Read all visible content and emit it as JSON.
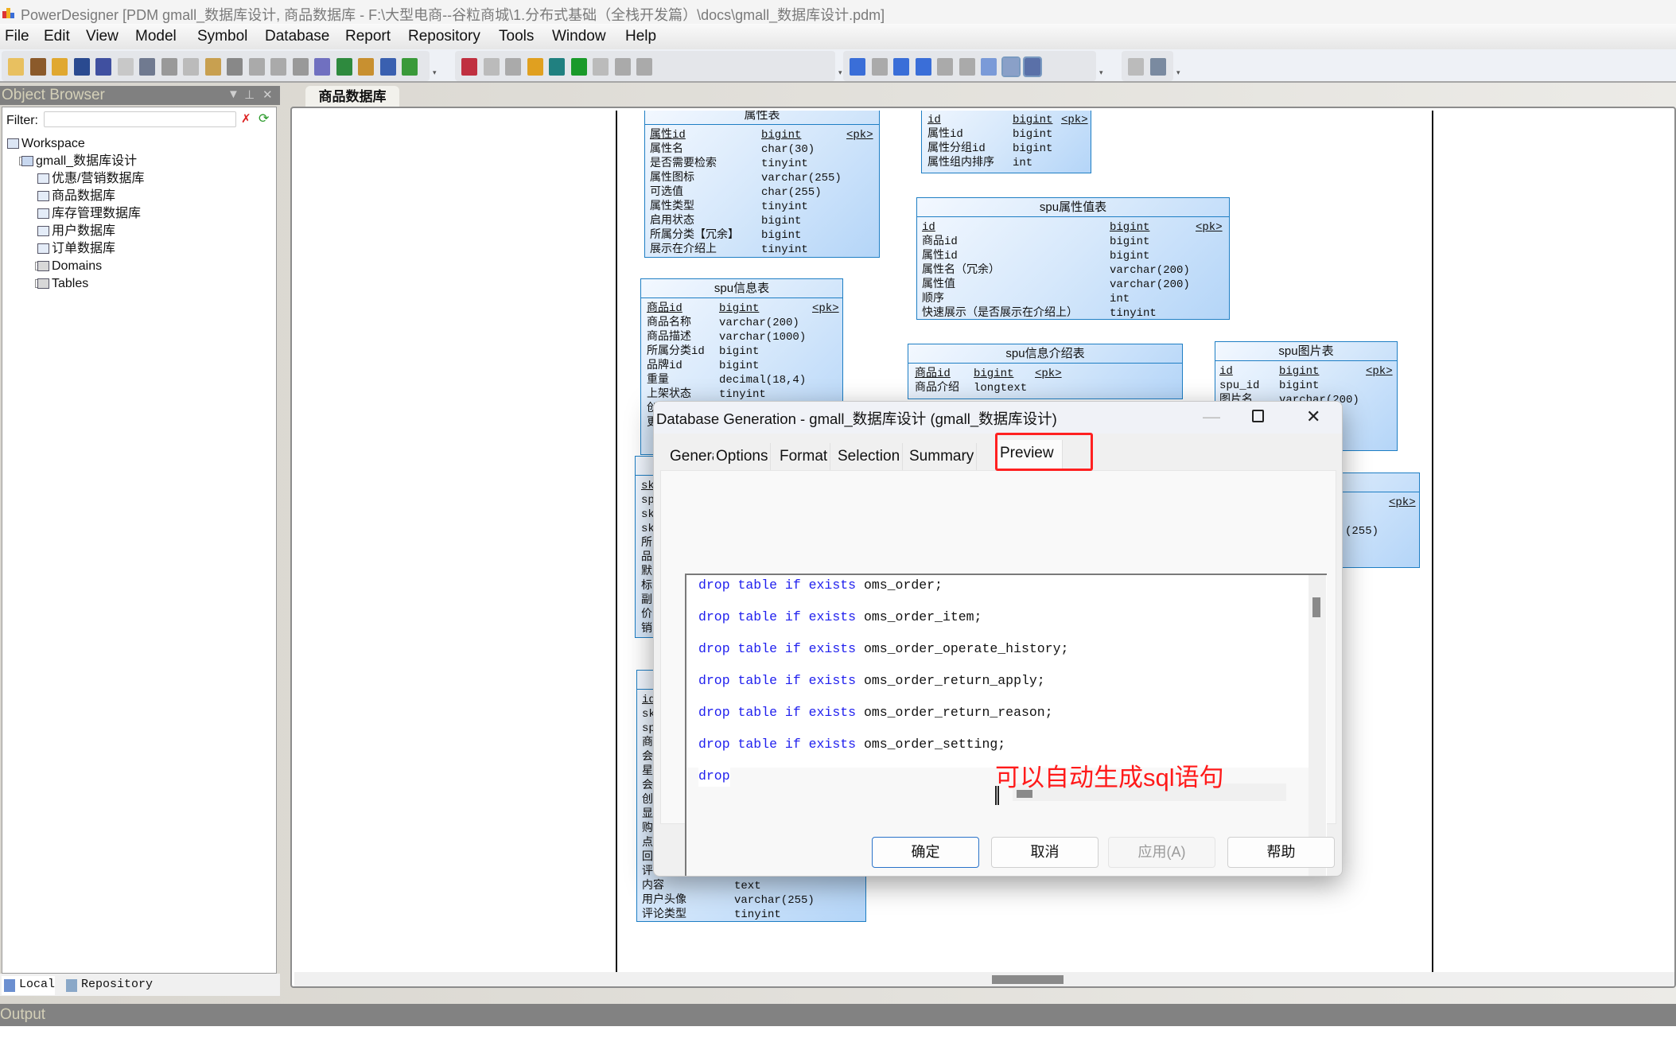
{
  "window": {
    "title": "PowerDesigner [PDM gmall_数据库设计, 商品数据库 - F:\\大型电商--谷粒商城\\1.分布式基础（全栈开发篇）\\docs\\gmall_数据库设计.pdm]"
  },
  "menu": [
    "File",
    "Edit",
    "View",
    "Model",
    "Symbol",
    "Database",
    "Report",
    "Repository",
    "Tools",
    "Window",
    "Help"
  ],
  "toolbar": {
    "icons": [
      "new-icon",
      "open-project-icon",
      "open-icon",
      "save-icon",
      "save-all-icon",
      "print-preview-icon",
      "print-icon",
      "cut-icon",
      "copy-icon",
      "paste-icon",
      "delete-icon",
      "undo-icon",
      "redo-icon",
      "properties-icon",
      "help-icon",
      "new-model-icon",
      "import-icon",
      "reverse-icon",
      "refresh-icon",
      "check-model-icon",
      "shadow-icon",
      "text-icon",
      "pen-icon",
      "fill-icon",
      "font-icon",
      "align-icon",
      "back-icon",
      "forward-icon",
      "diagram-icon",
      "object-icon",
      "package-icon",
      "list-icon",
      "link-icon",
      "entity-icon",
      "find-icon",
      "output-icon",
      "grid-icon",
      "zoom-icon",
      "printer-icon"
    ]
  },
  "object_browser": {
    "title": "Object Browser",
    "filter_label": "Filter:",
    "filter_value": "",
    "tree": {
      "workspace": "Workspace",
      "model": "gmall_数据库设计",
      "diagrams": [
        "优惠/营销数据库",
        "商品数据库",
        "库存管理数据库",
        "用户数据库",
        "订单数据库"
      ],
      "folders": [
        "Domains",
        "Tables"
      ]
    },
    "tabs": [
      "Local",
      "Repository"
    ]
  },
  "document_tab": "商品数据库",
  "output_label": "Output",
  "tables": [
    {
      "title": "属性表",
      "rows": [
        [
          "属性id",
          "bigint",
          "<pk>"
        ],
        [
          "属性名",
          "char(30)",
          ""
        ],
        [
          "是否需要检索",
          "tinyint",
          ""
        ],
        [
          "属性图标",
          "varchar(255)",
          ""
        ],
        [
          "可选值",
          "char(255)",
          ""
        ],
        [
          "属性类型",
          "tinyint",
          ""
        ],
        [
          "启用状态",
          "bigint",
          ""
        ],
        [
          "所属分类【冗余】",
          "bigint",
          ""
        ],
        [
          "展示在介绍上",
          "tinyint",
          ""
        ]
      ]
    },
    {
      "title": "",
      "rows": [
        [
          "id",
          "bigint",
          "<pk>"
        ],
        [
          "属性id",
          "bigint",
          ""
        ],
        [
          "属性分组id",
          "bigint",
          ""
        ],
        [
          "属性组内排序",
          "int",
          ""
        ]
      ]
    },
    {
      "title": "spu属性值表",
      "rows": [
        [
          "id",
          "bigint",
          "<pk>"
        ],
        [
          "商品id",
          "bigint",
          ""
        ],
        [
          "属性id",
          "bigint",
          ""
        ],
        [
          "属性名（冗余）",
          "varchar(200)",
          ""
        ],
        [
          "属性值",
          "varchar(200)",
          ""
        ],
        [
          "顺序",
          "int",
          ""
        ],
        [
          "快速展示（是否展示在介绍上）",
          "tinyint",
          ""
        ]
      ]
    },
    {
      "title": "spu信息表",
      "rows": [
        [
          "商品id",
          "bigint",
          "<pk>"
        ],
        [
          "商品名称",
          "varchar(200)",
          ""
        ],
        [
          "商品描述",
          "varchar(1000)",
          ""
        ],
        [
          "所属分类id",
          "bigint",
          ""
        ],
        [
          "品牌id",
          "bigint",
          ""
        ],
        [
          "重量",
          "decimal(18,4)",
          ""
        ],
        [
          "上架状态",
          "tinyint",
          ""
        ],
        [
          "创",
          "",
          ""
        ],
        [
          "更",
          "",
          ""
        ]
      ]
    },
    {
      "title": "spu信息介绍表",
      "rows": [
        [
          "商品id",
          "bigint",
          "<pk>"
        ],
        [
          "商品介绍",
          "longtext",
          ""
        ]
      ]
    },
    {
      "title": "spu图片表",
      "rows": [
        [
          "id",
          "bigint",
          "<pk>"
        ],
        [
          "spu_id",
          "bigint",
          ""
        ],
        [
          "图片名",
          "varchar(200)",
          ""
        ],
        [
          "",
          "5)",
          ""
        ]
      ]
    },
    {
      "title": "表",
      "rows": [
        [
          "",
          "",
          "<pk>"
        ],
        [
          "",
          "",
          ""
        ],
        [
          "",
          "(255)",
          ""
        ]
      ]
    },
    {
      "title": "",
      "rows": [
        [
          "sk",
          "",
          ""
        ],
        [
          "sp",
          "",
          ""
        ],
        [
          "sk",
          "",
          ""
        ],
        [
          "sk",
          "",
          ""
        ],
        [
          "所",
          "",
          ""
        ],
        [
          "品",
          "",
          ""
        ],
        [
          "默",
          "",
          ""
        ],
        [
          "标",
          "",
          ""
        ],
        [
          "副",
          "",
          ""
        ],
        [
          "价",
          "",
          ""
        ],
        [
          "销",
          "",
          ""
        ]
      ]
    },
    {
      "title": "",
      "rows": [
        [
          "id",
          "",
          ""
        ],
        [
          "sk",
          "",
          ""
        ],
        [
          "sp",
          "",
          ""
        ],
        [
          "商",
          "",
          ""
        ],
        [
          "会",
          "",
          ""
        ],
        [
          "星",
          "",
          ""
        ],
        [
          "会",
          "",
          ""
        ],
        [
          "创",
          "",
          ""
        ],
        [
          "显",
          "",
          ""
        ],
        [
          "购",
          "",
          ""
        ],
        [
          "点",
          "",
          ""
        ],
        [
          "回",
          "",
          ""
        ],
        [
          "评",
          "",
          ""
        ],
        [
          "内容",
          "text",
          ""
        ],
        [
          "用户头像",
          "varchar(255)",
          ""
        ],
        [
          "评论类型",
          "tinyint",
          ""
        ]
      ]
    }
  ],
  "dialog": {
    "title": "Database Generation - gmall_数据库设计 (gmall_数据库设计)",
    "tabs": [
      "General",
      "Options",
      "Format",
      "Selection",
      "Summary",
      "Preview"
    ],
    "active_tab": "Preview",
    "preview_lines": [
      {
        "keyword": "drop table if exists ",
        "name": "oms_order;"
      },
      {
        "keyword": "drop table if exists ",
        "name": "oms_order_item;"
      },
      {
        "keyword": "drop table if exists ",
        "name": "oms_order_operate_history;"
      },
      {
        "keyword": "drop table if exists ",
        "name": "oms_order_return_apply;"
      },
      {
        "keyword": "drop table if exists ",
        "name": "oms_order_return_reason;"
      },
      {
        "keyword": "drop table if exists ",
        "name": "oms_order_setting;"
      },
      {
        "keyword": "drop",
        "name": ""
      }
    ],
    "annotation": "可以自动生成sql语句",
    "buttons": {
      "ok": "确定",
      "cancel": "取消",
      "apply": "应用(A)",
      "help": "帮助"
    }
  },
  "colors": {
    "keyword": "#2020ee",
    "annotation": "#ff1a1a",
    "highlight_box": "#ff2020",
    "table_border": "#1e7ec4"
  }
}
